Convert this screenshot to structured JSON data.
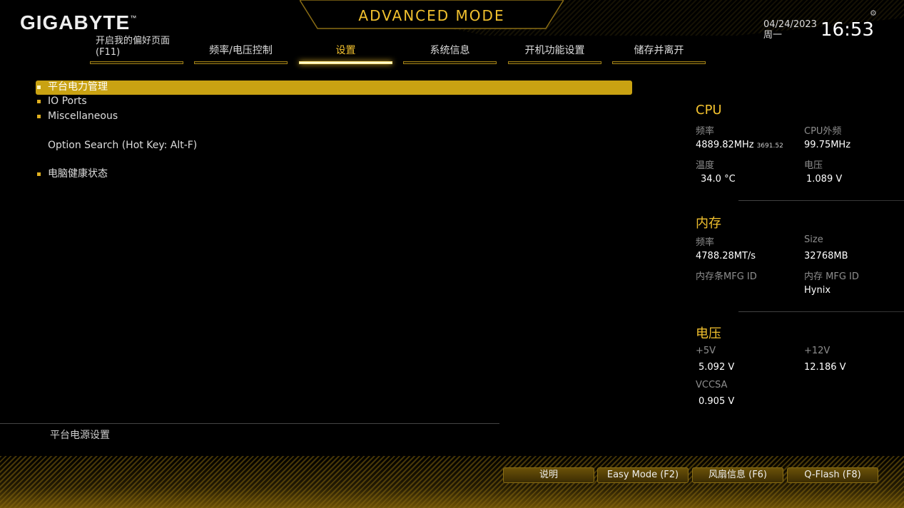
{
  "brand": {
    "logo": "GIGABYTE",
    "tm": "™"
  },
  "header": {
    "title": "ADVANCED MODE",
    "date": "04/24/2023",
    "weekday": "周一",
    "time": "16:53",
    "settings_icon": "gear-icon"
  },
  "tabs": [
    {
      "label": "开启我的偏好页面",
      "sub": "(F11)"
    },
    {
      "label": "频率/电压控制"
    },
    {
      "label": "设置",
      "active": true
    },
    {
      "label": "系统信息"
    },
    {
      "label": "开机功能设置"
    },
    {
      "label": "储存并离开"
    }
  ],
  "menu": {
    "items": [
      {
        "label": "平台电力管理",
        "bullet": true,
        "selected": true
      },
      {
        "label": "IO Ports",
        "bullet": true
      },
      {
        "label": "Miscellaneous",
        "bullet": true
      },
      {
        "label": "Option Search (Hot Key: Alt-F)",
        "bullet": false
      },
      {
        "label": "电脑健康状态",
        "bullet": true
      }
    ]
  },
  "help": {
    "text": "平台电源设置"
  },
  "cpu": {
    "title": "CPU",
    "freq_label": "频率",
    "freq_value": "4889.82MHz",
    "freq_small": "3691.52",
    "bclk_label": "CPU外频",
    "bclk_value": "99.75MHz",
    "temp_label": "温度",
    "temp_value": "34.0 °C",
    "volt_label": "电压",
    "volt_value": "1.089 V"
  },
  "memory": {
    "title": "内存",
    "freq_label": "频率",
    "freq_value": "4788.28MT/s",
    "size_label": "Size",
    "size_value": "32768MB",
    "stick_mfg_label": "内存条MFG ID",
    "mfg_label": "内存 MFG ID",
    "mfg_value": "Hynix"
  },
  "voltage": {
    "title": "电压",
    "v5_label": "+5V",
    "v5_value": "5.092 V",
    "v12_label": "+12V",
    "v12_value": "12.186 V",
    "vccsa_label": "VCCSA",
    "vccsa_value": "0.905 V"
  },
  "bottom_buttons": [
    {
      "label": "说明"
    },
    {
      "label": "Easy Mode (F2)"
    },
    {
      "label": "风扇信息 (F6)"
    },
    {
      "label": "Q-Flash (F8)"
    }
  ],
  "colors": {
    "accent": "#f2c12e",
    "highlight": "#c9a212",
    "background": "#000000"
  }
}
